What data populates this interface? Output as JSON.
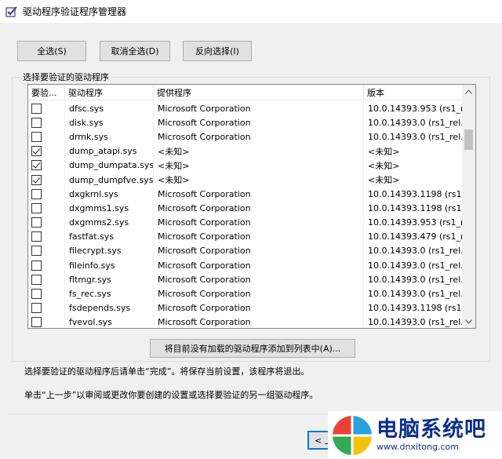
{
  "window": {
    "title": "驱动程序验证程序管理器"
  },
  "buttons": {
    "select_all": "全选(S)",
    "deselect_all": "取消全选(D)",
    "invert": "反向选择(I)",
    "add_unloaded": "将目前没有加载的驱动程序添加到列表中(A)...",
    "back": "< 上"
  },
  "group": {
    "label": "选择要验证的驱动程序"
  },
  "list": {
    "headers": [
      "要验...",
      "驱动程序",
      "提供程序",
      "版本"
    ],
    "rows": [
      {
        "checked": false,
        "driver": "dfsc.sys",
        "provider": "Microsoft Corporation",
        "version": "10.0.14393.953 (rs1_r..."
      },
      {
        "checked": false,
        "driver": "disk.sys",
        "provider": "Microsoft Corporation",
        "version": "10.0.14393.0 (rs1_rel..."
      },
      {
        "checked": false,
        "driver": "drmk.sys",
        "provider": "Microsoft Corporation",
        "version": "10.0.14393.0 (rs1_rel..."
      },
      {
        "checked": true,
        "driver": "dump_atapi.sys",
        "provider": "<未知>",
        "version": "<未知>"
      },
      {
        "checked": true,
        "driver": "dump_dumpata.sys",
        "provider": "<未知>",
        "version": "<未知>"
      },
      {
        "checked": true,
        "driver": "dump_dumpfve.sys",
        "provider": "<未知>",
        "version": "<未知>"
      },
      {
        "checked": false,
        "driver": "dxgkrnl.sys",
        "provider": "Microsoft Corporation",
        "version": "10.0.14393.1198 (rs1..."
      },
      {
        "checked": false,
        "driver": "dxgmms1.sys",
        "provider": "Microsoft Corporation",
        "version": "10.0.14393.1198 (rs1..."
      },
      {
        "checked": false,
        "driver": "dxgmms2.sys",
        "provider": "Microsoft Corporation",
        "version": "10.0.14393.953 (rs1_r..."
      },
      {
        "checked": false,
        "driver": "fastfat.sys",
        "provider": "Microsoft Corporation",
        "version": "10.0.14393.479 (rs1_r..."
      },
      {
        "checked": false,
        "driver": "filecrypt.sys",
        "provider": "Microsoft Corporation",
        "version": "10.0.14393.0 (rs1_rel..."
      },
      {
        "checked": false,
        "driver": "fileinfo.sys",
        "provider": "Microsoft Corporation",
        "version": "10.0.14393.0 (rs1_rel..."
      },
      {
        "checked": false,
        "driver": "fltmgr.sys",
        "provider": "Microsoft Corporation",
        "version": "10.0.14393.0 (rs1_rel..."
      },
      {
        "checked": false,
        "driver": "fs_rec.sys",
        "provider": "Microsoft Corporation",
        "version": "10.0.14393.0 (rs1_rel..."
      },
      {
        "checked": false,
        "driver": "fsdepends.sys",
        "provider": "Microsoft Corporation",
        "version": "10.0.14393.1198 (rs1..."
      },
      {
        "checked": false,
        "driver": "fvevol.sys",
        "provider": "Microsoft Corporation",
        "version": "10.0.14393.0 (rs1_rel..."
      }
    ]
  },
  "info": {
    "line1": "选择要验证的驱动程序后请单击“完成”。将保存当前设置，该程序将退出。",
    "line2": "单击“上一步”以审阅或更改你要创建的设置或选择要验证的另一组驱动程序。"
  },
  "watermark": {
    "name": "电脑系统吧",
    "url": "www.dnxitong.com"
  },
  "colors": {
    "accent": "#0078d7",
    "dialog_bg": "#f0f0f0",
    "watermark_blue": "#0b2f8b"
  }
}
